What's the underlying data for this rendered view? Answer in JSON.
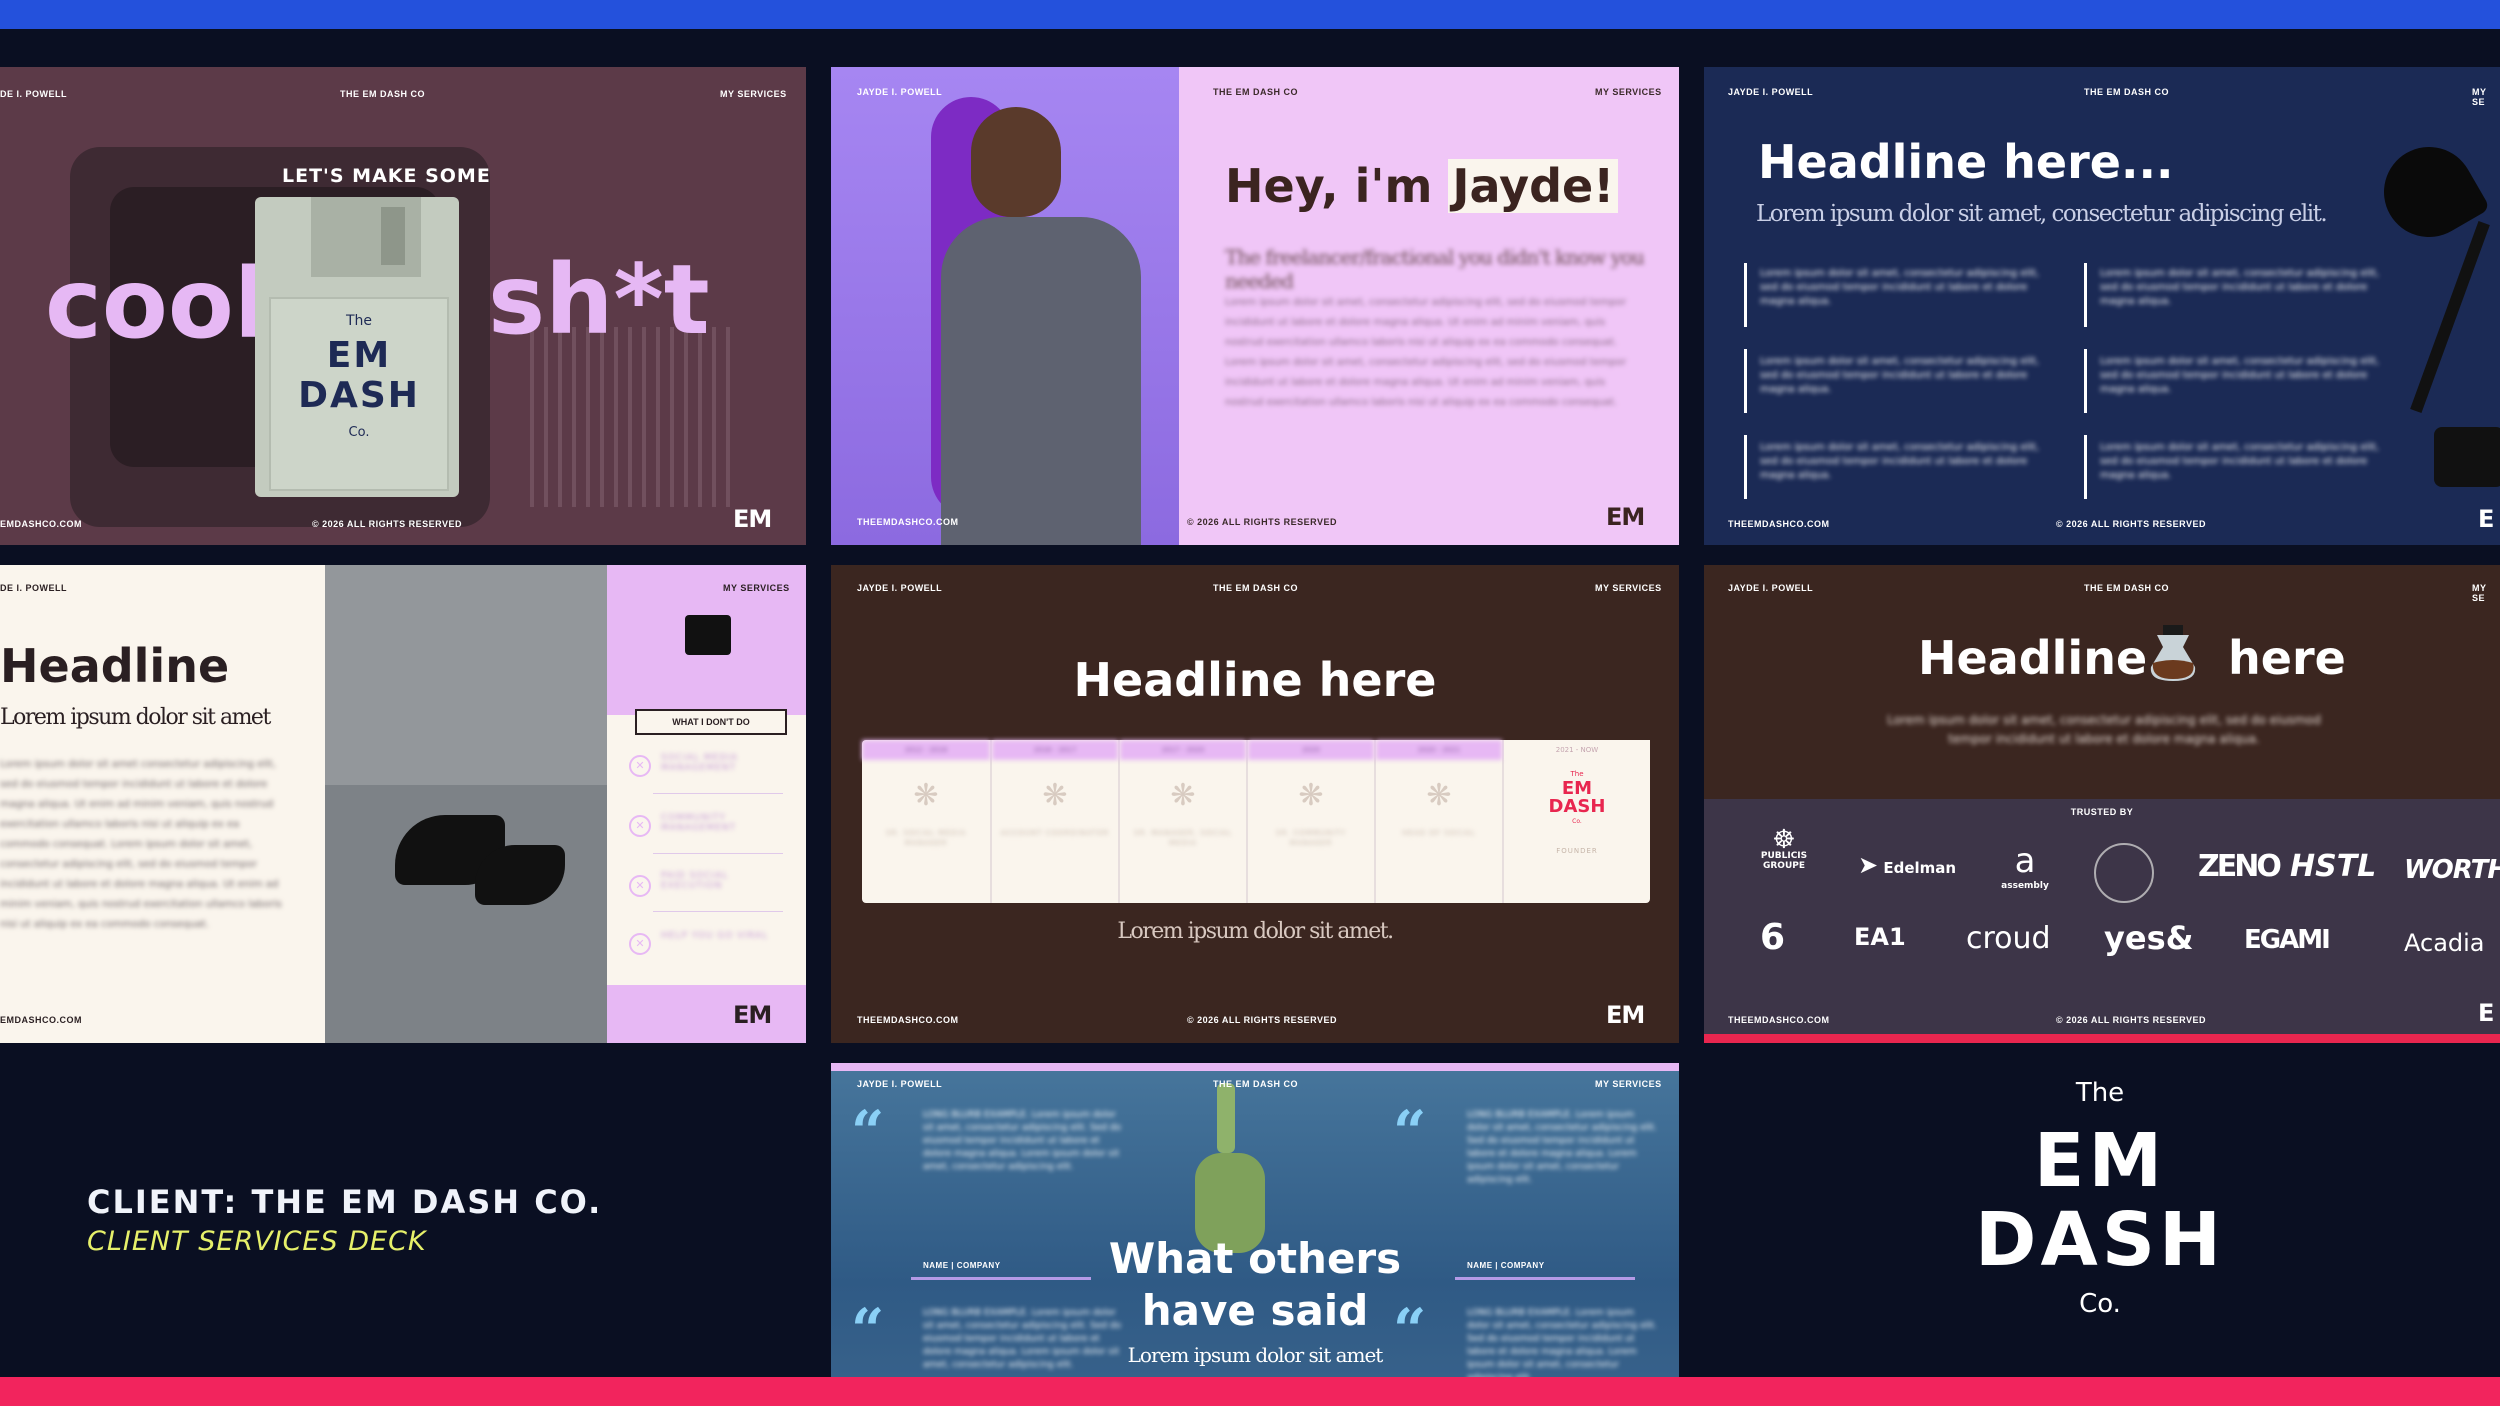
{
  "colors": {
    "top_bar": "#2451dc",
    "bottom_bar": "#f2245d",
    "background": "#0a0f22",
    "accent_lilac": "#e7b8f4",
    "accent_yellow": "#e6f06a"
  },
  "common": {
    "name": "JAYDE I. POWELL",
    "company": "THE EM DASH CO",
    "services": "MY SERVICES",
    "website": "THEEMDASHCO.COM",
    "rights": "© 2026 ALL RIGHTS RESERVED",
    "logo": "EM"
  },
  "slide1": {
    "name_partial": "DE I. POWELL",
    "tagline": "LET'S MAKE SOME",
    "word_left": "cool",
    "word_right": "sh*t",
    "floppy": {
      "the": "The",
      "em": "EM",
      "dash": "DASH",
      "co": "Co."
    },
    "website_partial": "EMDASHCO.COM"
  },
  "slide2": {
    "title_pre": "Hey, i'm ",
    "title_name": "Jayde!",
    "subtitle": "The freelancer/fractional you didn't know you needed",
    "body": "Lorem ipsum dolor sit amet, consectetur adipiscing elit, sed do eiusmod tempor incididunt ut labore et dolore magna aliqua. Ut enim ad minim veniam, quis nostrud exercitation ullamco laboris nisi ut aliquip ex ea commodo consequat. Lorem ipsum dolor sit amet, consectetur adipiscing elit, sed do eiusmod tempor incididunt ut labore et dolore magna aliqua. Ut enim ad minim veniam, quis nostrud exercitation ullamco laboris nisi ut aliquip ex ea commodo consequat."
  },
  "slide3": {
    "title": "Headline here...",
    "subtitle": "Lorem ipsum dolor sit amet, consectetur adipiscing elit.",
    "cell": "Lorem ipsum dolor sit amet, consectetur adipiscing elit, sed do eiusmod tempor incididunt ut labore et dolore magna aliqua.",
    "services_partial": "MY SE",
    "logo_partial": "E"
  },
  "slide4": {
    "name_partial": "DE I. POWELL",
    "title": "Headline",
    "subtitle": "Lorem ipsum dolor sit amet",
    "body": "Lorem ipsum dolor sit amet consectetur adipiscing elit, sed do eiusmod tempor incididunt ut labore et dolore magna aliqua. Ut enim ad minim veniam, quis nostrud exercitation ullamco laboris nisi ut aliquip ex ea commodo consequat. Lorem ipsum dolor sit amet, consectetur adipiscing elit, sed do eiusmod tempor incididunt ut labore et dolore magna aliqua. Ut enim ad minim veniam, quis nostrud exercitation ullamco laboris nisi ut aliquip ex ea commodo consequat.",
    "pill": "WHAT I DON'T DO",
    "items": [
      "SOCIAL MEDIA MANAGEMENT",
      "COMMUNITY MANAGEMENT",
      "PAID SOCIAL EXECUTION",
      "HELP YOU GO VIRAL"
    ],
    "website_partial": "EMDASHCO.COM"
  },
  "slide5": {
    "title": "Headline here",
    "subtitle": "Lorem ipsum dolor sit amet.",
    "timeline": [
      {
        "years": "2012 - 2016",
        "label": "SR. SOCIAL MEDIA MANAGER"
      },
      {
        "years": "2016 - 2017",
        "label": "ACCOUNT COORDINATOR"
      },
      {
        "years": "2017 - 2020",
        "label": "SR. MANAGER, SOCIAL MEDIA"
      },
      {
        "years": "2020",
        "label": "SR. COMMUNITY MANAGER"
      },
      {
        "years": "2020 - 2021",
        "label": "HEAD OF SOCIAL"
      },
      {
        "years": "2021 - NOW",
        "label": "FOUNDER",
        "brand_the": "The",
        "brand_em": "EM",
        "brand_dash": "DASH",
        "brand_co": "Co."
      }
    ]
  },
  "slide6": {
    "title_left": "Headline",
    "title_right": "here",
    "subtitle": "Lorem ipsum dolor sit amet, consectetur adipiscing elit, sed do eiusmod tempor incididunt ut labore et dolore magna aliqua.",
    "trusted_by": "TRUSTED BY",
    "logos_row1": [
      "PUBLICIS GROUPE",
      "Edelman",
      "assembly",
      "",
      "ZENO",
      "HSTL",
      "WORTHI"
    ],
    "logos_row2": [
      "",
      "EA1",
      "croud",
      "yes&",
      "EGAMI",
      "Acadia"
    ],
    "assembly_glyph": "a",
    "logo_partial": "E"
  },
  "slide7": {
    "quote_text": "LONG BLURB EXAMPLE. Lorem ipsum dolor sit amet, consectetur adipiscing elit. Sed do eiusmod tempor incididunt ut labore et dolore magna aliqua. Lorem ipsum dolor sit amet, consectetur adipiscing elit.",
    "name_company": "NAME | COMPANY",
    "title_line1": "What others",
    "title_line2": "have said",
    "subtitle": "Lorem ipsum dolor sit amet",
    "quote_mark": "“"
  },
  "client": {
    "line1": "CLIENT: THE EM DASH CO.",
    "line2": "CLIENT SERVICES DECK"
  },
  "brand": {
    "the": "The",
    "em": "EM",
    "dash": "DASH",
    "co": "Co."
  }
}
